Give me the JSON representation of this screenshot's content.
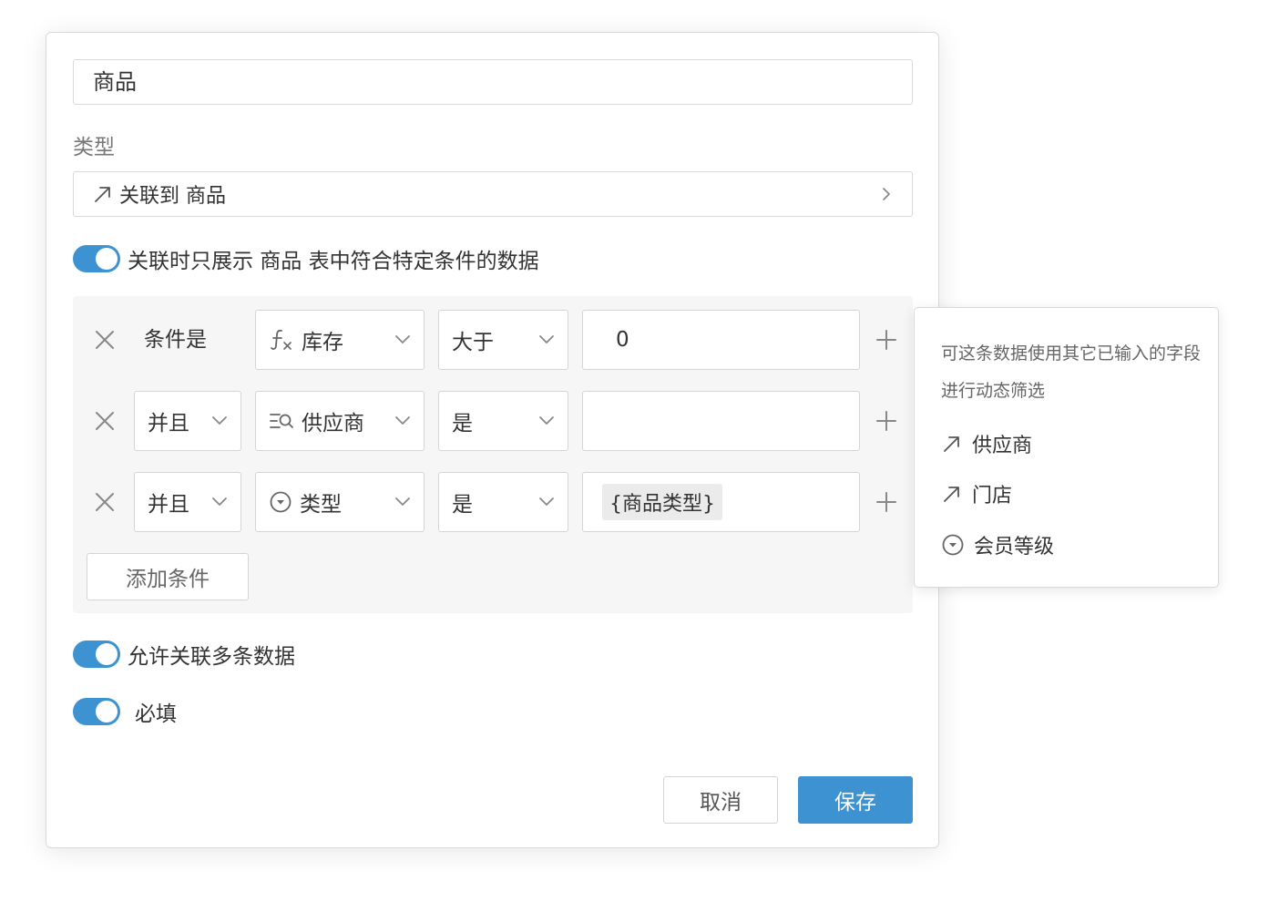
{
  "form": {
    "name_value": "商品",
    "type_label": "类型",
    "type_value": "关联到 商品",
    "filter_toggle_label": "关联时只展示 商品 表中符合特定条件的数据",
    "filter_toggle_on": true,
    "conditions": [
      {
        "prefix": "条件是",
        "field": "库存",
        "field_icon": "formula-icon",
        "operator": "大于",
        "value": "0"
      },
      {
        "prefix": "并且",
        "field": "供应商",
        "field_icon": "lookup-icon",
        "operator": "是",
        "value": ""
      },
      {
        "prefix": "并且",
        "field": "类型",
        "field_icon": "dropdown-circle-icon",
        "operator": "是",
        "value": "{商品类型}"
      }
    ],
    "add_condition_label": "添加条件",
    "multi_toggle_label": "允许关联多条数据",
    "multi_toggle_on": true,
    "required_toggle_label": "必填",
    "required_toggle_on": true,
    "cancel_label": "取消",
    "save_label": "保存"
  },
  "popover": {
    "hint": "可这条数据使用其它已输入的字段进行动态筛选",
    "items": [
      {
        "label": "供应商",
        "icon": "link-arrow-icon"
      },
      {
        "label": "门店",
        "icon": "link-arrow-icon"
      },
      {
        "label": "会员等级",
        "icon": "dropdown-circle-icon"
      }
    ]
  },
  "colors": {
    "accent": "#3d92d1",
    "border": "#d9d9d9",
    "condition_bg": "#f6f6f6",
    "chip_bg": "#ebebeb"
  }
}
